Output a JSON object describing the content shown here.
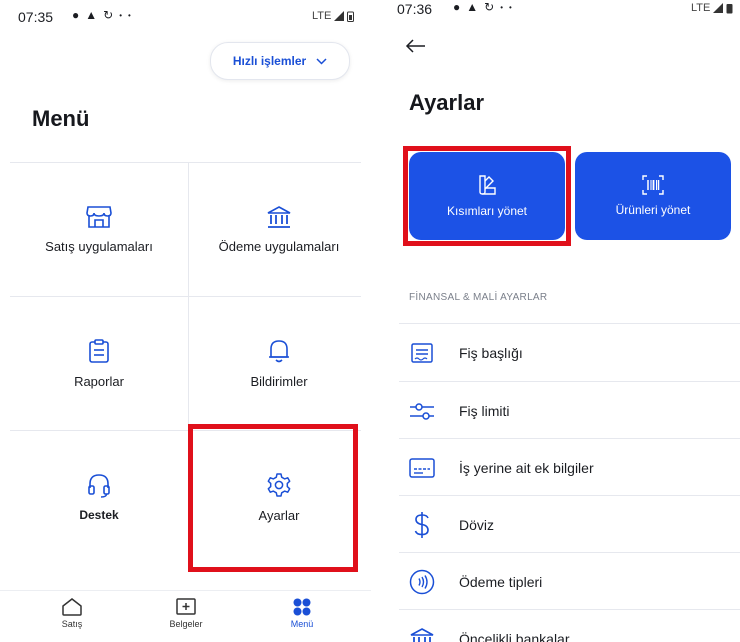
{
  "left": {
    "status": {
      "time": "07:35",
      "network": "LTE"
    },
    "quick_actions_label": "Hızlı işlemler",
    "title": "Menü",
    "items": [
      {
        "label": "Satış uygulamaları",
        "icon": "store-icon"
      },
      {
        "label": "Ödeme uygulamaları",
        "icon": "bank-icon"
      },
      {
        "label": "Raporlar",
        "icon": "clipboard-icon"
      },
      {
        "label": "Bildirimler",
        "icon": "bell-icon"
      },
      {
        "label": "Destek",
        "icon": "headset-icon"
      },
      {
        "label": "Ayarlar",
        "icon": "gear-icon"
      }
    ],
    "bottom_nav": [
      {
        "label": "Satış",
        "icon": "home-icon"
      },
      {
        "label": "Belgeler",
        "icon": "document-add-icon"
      },
      {
        "label": "Menü",
        "icon": "grid-dots-icon",
        "active": true
      }
    ]
  },
  "right": {
    "status": {
      "time": "07:36",
      "network": "LTE"
    },
    "title": "Ayarlar",
    "actions": [
      {
        "label": "Kısımları yönet",
        "icon": "swatch-icon"
      },
      {
        "label": "Ürünleri yönet",
        "icon": "barcode-icon"
      }
    ],
    "section_title": "FİNANSAL & MALİ AYARLAR",
    "rows": [
      {
        "label": "Fiş başlığı",
        "icon": "receipt-icon"
      },
      {
        "label": "Fiş limiti",
        "icon": "sliders-icon"
      },
      {
        "label": "İş yerine ait ek bilgiler",
        "icon": "card-icon"
      },
      {
        "label": "Döviz",
        "icon": "dollar-icon"
      },
      {
        "label": "Ödeme tipleri",
        "icon": "contactless-icon"
      },
      {
        "label": "Öncelikli bankalar",
        "icon": "bank-icon"
      }
    ]
  },
  "colors": {
    "accent": "#1c52e6",
    "highlight": "#e0101b"
  }
}
